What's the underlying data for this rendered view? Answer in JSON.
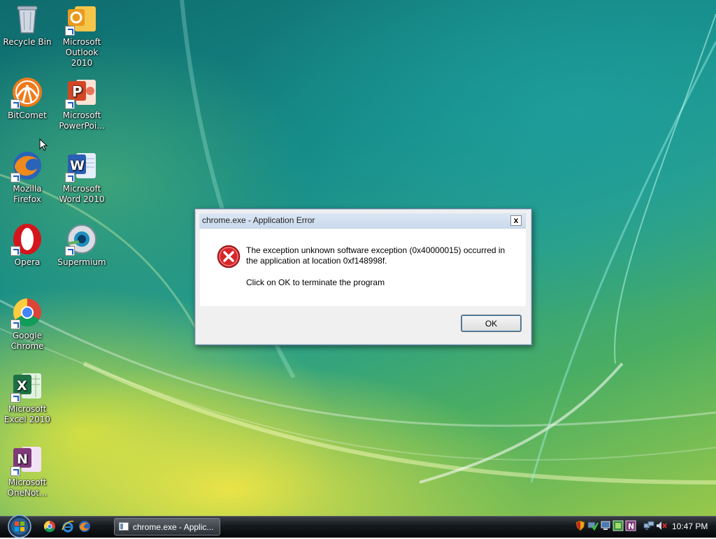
{
  "desktop": {
    "icons": [
      {
        "label": "Recycle Bin",
        "icon": "recycle-bin-icon"
      },
      {
        "label": "Microsoft\nOutlook 2010",
        "icon": "outlook-icon"
      },
      {
        "label": "BitComet",
        "icon": "bitcomet-icon"
      },
      {
        "label": "Microsoft\nPowerPoi...",
        "icon": "powerpoint-icon"
      },
      {
        "label": "Mozilla\nFirefox",
        "icon": "firefox-icon"
      },
      {
        "label": "Microsoft\nWord 2010",
        "icon": "word-icon"
      },
      {
        "label": "Opera",
        "icon": "opera-icon"
      },
      {
        "label": "Supermium",
        "icon": "supermium-icon"
      },
      {
        "label": "Google\nChrome",
        "icon": "chrome-icon"
      },
      {
        "label": "Microsoft\nExcel 2010",
        "icon": "excel-icon"
      },
      {
        "label": "Microsoft\nOneNot...",
        "icon": "onenote-icon"
      }
    ]
  },
  "dialog": {
    "title": "chrome.exe - Application Error",
    "close_label": "x",
    "message_line1": "The exception unknown software exception (0x40000015) occurred in the application at location 0xf148998f.",
    "message_line2": "Click on OK to terminate the program",
    "ok_label": "OK",
    "icon": "error-icon"
  },
  "taskbar": {
    "start": "start-orb-icon",
    "quick_launch": [
      "chrome-icon",
      "internet-explorer-icon",
      "firefox-icon"
    ],
    "more_label": "»",
    "task_label": "chrome.exe - Applic...",
    "tray_icons": [
      "security-shield-icon",
      "network-check-icon",
      "monitor-icon",
      "green-app-icon",
      "onenote-icon",
      "network-icon",
      "volume-muted-icon"
    ],
    "clock": "10:47 PM"
  }
}
